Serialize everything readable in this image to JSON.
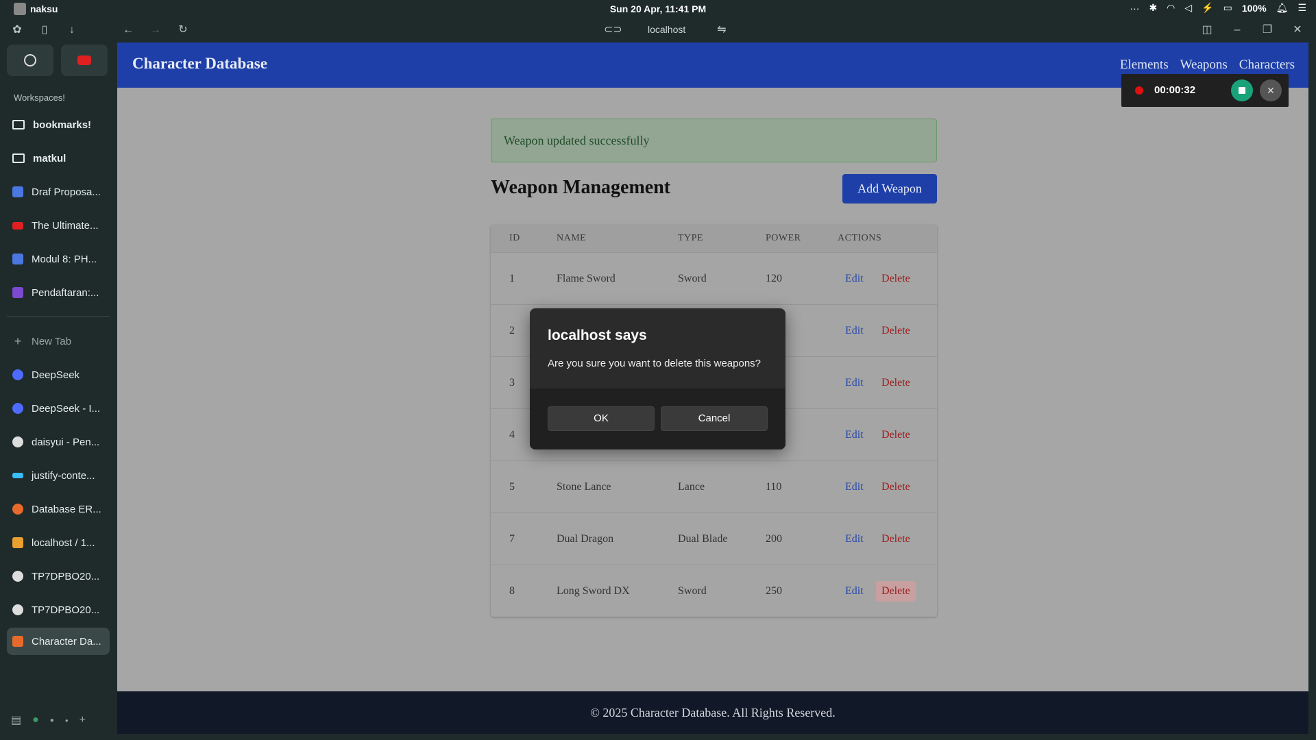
{
  "os": {
    "user": "naksu",
    "clock": "Sun 20 Apr, 11:41 PM",
    "battery": "100%",
    "tray_icons": [
      "more-icon",
      "bluetooth-icon",
      "wifi-icon",
      "volume-icon",
      "power-icon",
      "battery-icon",
      "notification-icon",
      "settings-icon"
    ]
  },
  "browser": {
    "url": "localhost"
  },
  "sidebar": {
    "workspaces_label": "Workspaces!",
    "items": [
      {
        "label": "bookmarks!",
        "icon": "folder-icon"
      },
      {
        "label": "matkul",
        "icon": "folder-icon"
      },
      {
        "label": "Draf Proposa...",
        "icon": "docs-icon",
        "color": "#4a78e0"
      },
      {
        "label": "The Ultimate...",
        "icon": "youtube-icon",
        "color": "#e02020"
      },
      {
        "label": "Modul 8: PH...",
        "icon": "docs-icon",
        "color": "#4a78e0"
      },
      {
        "label": "Pendaftaran:...",
        "icon": "forms-icon",
        "color": "#7b4ad0"
      },
      {
        "label": "New Tab",
        "icon": "plus-icon"
      },
      {
        "label": "DeepSeek",
        "icon": "deepseek-icon",
        "color": "#4d6bfe"
      },
      {
        "label": "DeepSeek - I...",
        "icon": "deepseek-icon",
        "color": "#4d6bfe"
      },
      {
        "label": "daisyui - Pen...",
        "icon": "google-icon",
        "color": "#dddddd"
      },
      {
        "label": "justify-conte...",
        "icon": "tailwind-icon",
        "color": "#38bdf8"
      },
      {
        "label": "Database ER...",
        "icon": "db-icon",
        "color": "#e86a2a"
      },
      {
        "label": "localhost / 1...",
        "icon": "phpmyadmin-icon",
        "color": "#e8a030"
      },
      {
        "label": "TP7DPBO20...",
        "icon": "github-icon",
        "color": "#dddddd"
      },
      {
        "label": "TP7DPBO20...",
        "icon": "github-icon",
        "color": "#dddddd"
      },
      {
        "label": "Character Da...",
        "icon": "site-icon",
        "color": "#e86a2a"
      }
    ]
  },
  "site": {
    "title": "Character Database",
    "nav": [
      "Elements",
      "Weapons",
      "Characters"
    ],
    "footer": "© 2025 Character Database. All Rights Reserved."
  },
  "recorder": {
    "time": "00:00:32"
  },
  "alert": {
    "message": "Weapon updated successfully"
  },
  "main": {
    "heading": "Weapon Management",
    "add_button": "Add Weapon"
  },
  "table": {
    "headers": [
      "ID",
      "NAME",
      "TYPE",
      "POWER",
      "ACTIONS"
    ],
    "edit_label": "Edit",
    "delete_label": "Delete",
    "rows": [
      {
        "id": "1",
        "name": "Flame Sword",
        "type": "Sword",
        "power": "120"
      },
      {
        "id": "2",
        "name": "",
        "type": "",
        "power": ""
      },
      {
        "id": "3",
        "name": "",
        "type": "",
        "power": ""
      },
      {
        "id": "4",
        "name": "",
        "type": "",
        "power": ""
      },
      {
        "id": "5",
        "name": "Stone Lance",
        "type": "Lance",
        "power": "110"
      },
      {
        "id": "7",
        "name": "Dual Dragon",
        "type": "Dual Blade",
        "power": "200"
      },
      {
        "id": "8",
        "name": "Long Sword DX",
        "type": "Sword",
        "power": "250"
      }
    ]
  },
  "dialog": {
    "title": "localhost says",
    "message": "Are you sure you want to delete this weapons?",
    "ok": "OK",
    "cancel": "Cancel"
  }
}
